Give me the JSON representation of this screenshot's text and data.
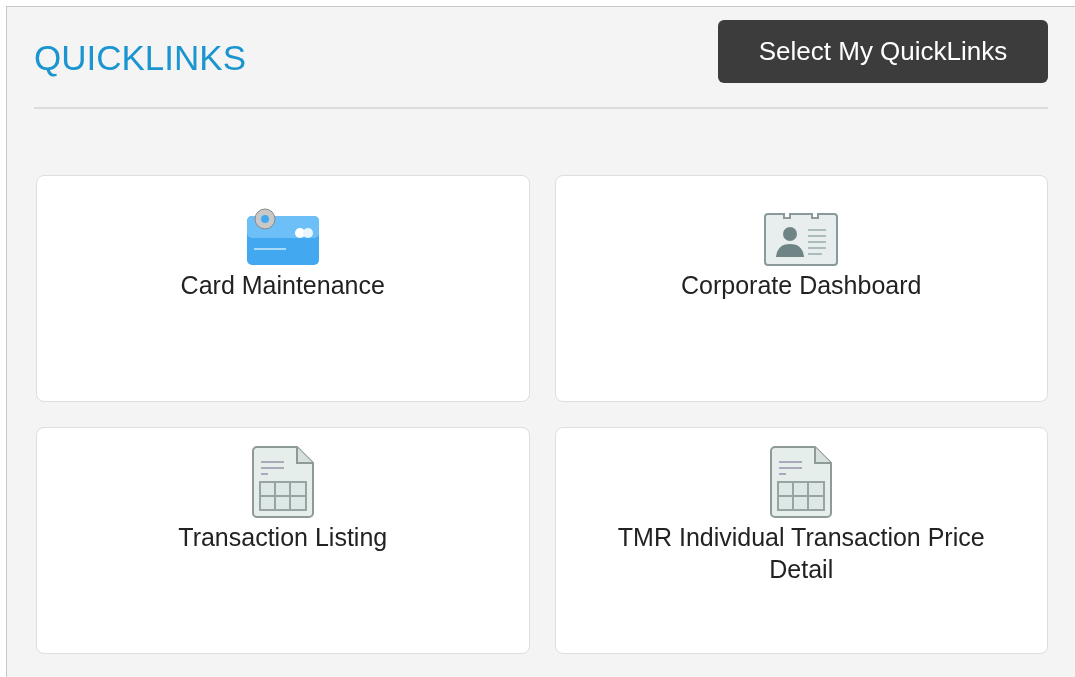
{
  "header": {
    "title": "QUICKLINKS",
    "button": "Select My QuickLinks"
  },
  "links": [
    {
      "kind": "card",
      "label": "Card Maintenance"
    },
    {
      "kind": "id-card",
      "label": "Corporate Dashboard"
    },
    {
      "kind": "sheet",
      "label": "Transaction Listing"
    },
    {
      "kind": "sheet",
      "label": "TMR Individual Transaction Price Detail"
    }
  ]
}
